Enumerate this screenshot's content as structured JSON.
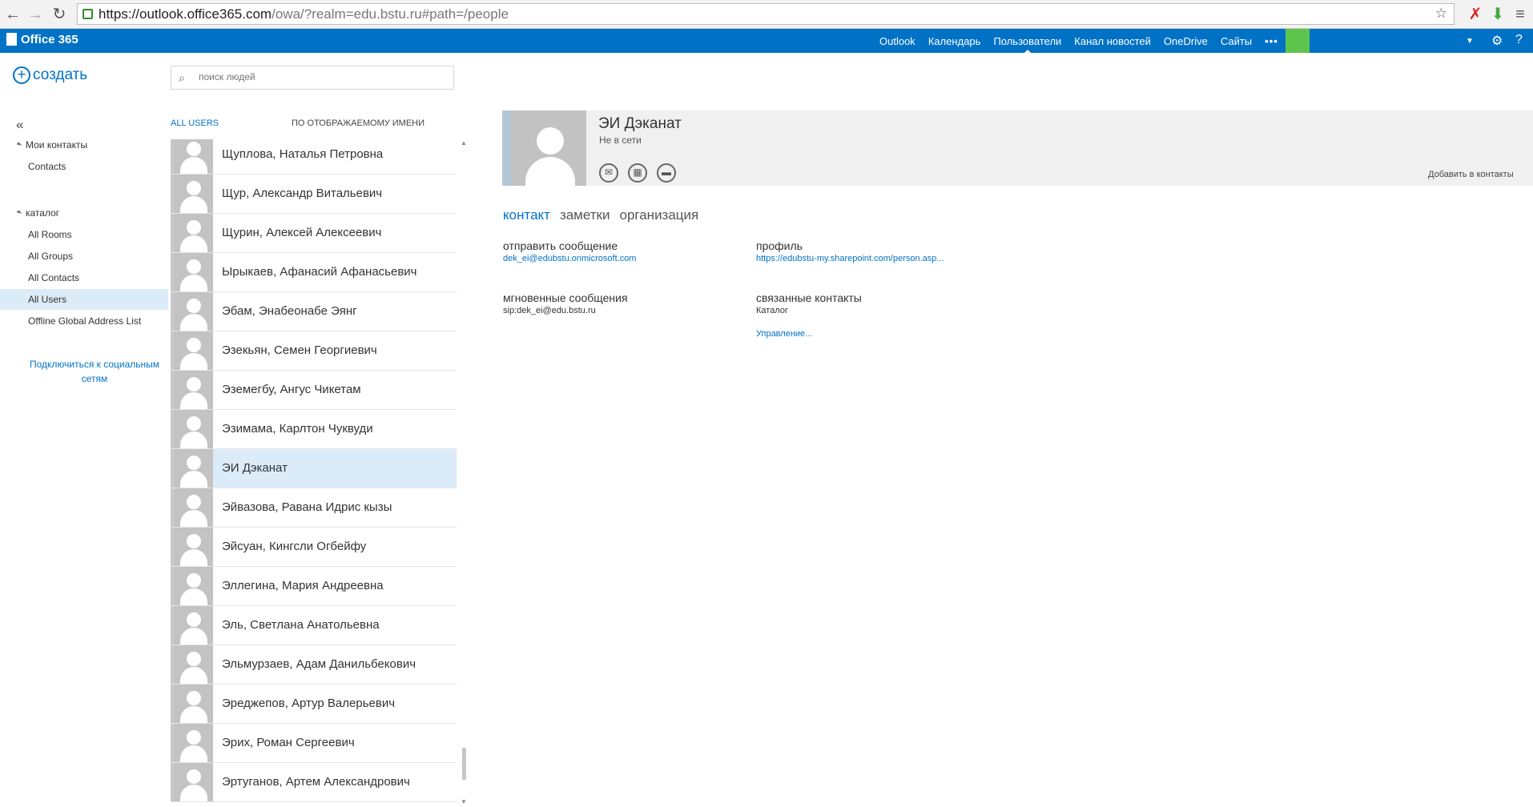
{
  "browser": {
    "url_host": "https://outlook.office365.com",
    "url_rest": "/owa/?realm=edu.bstu.ru#path=/people"
  },
  "suite_bar": {
    "logo": "Office 365",
    "nav": [
      "Outlook",
      "Календарь",
      "Пользователи",
      "Канал новостей",
      "OneDrive",
      "Сайты"
    ],
    "active_nav": "Пользователи",
    "more": "•••",
    "settings_glyph": "⚙",
    "help_glyph": "?"
  },
  "toolbar": {
    "new_label": "создать",
    "search_placeholder": "поиск людей"
  },
  "left_pane": {
    "my_contacts": "Мои контакты",
    "my_contacts_items": [
      "Contacts"
    ],
    "directory": "каталог",
    "directory_items": [
      "All Rooms",
      "All Groups",
      "All Contacts",
      "All Users",
      "Offline Global Address List"
    ],
    "selected_item": "All Users",
    "social_link": "Подключиться к социальным сетям"
  },
  "list": {
    "filter": "ALL USERS",
    "sort": "ПО ОТОБРАЖАЕМОМУ ИМЕНИ",
    "people": [
      "Щуплова, Наталья Петровна",
      "Щур, Александр Витальевич",
      "Щурин, Алексей Алексеевич",
      "Ырыкаев, Афанасий Афанасьевич",
      "Эбам, Энабеонабе Эянг",
      "Эзекьян, Семен Георгиевич",
      "Эземегбу, Ангус Чикетам",
      "Эзимама, Карлтон Чуквуди",
      "ЭИ Дэканат",
      "Эйвазова, Равана Идрис кызы",
      "Эйсуан, Кингсли Огбейфу",
      "Эллегина, Мария Андреевна",
      "Эль, Светлана Анатольевна",
      "Эльмурзаев, Адам Данильбекович",
      "Эреджепов, Артур Валерьевич",
      "Эрих, Роман Сергеевич",
      "Эртуганов, Артем Александрович"
    ],
    "selected_index": 8
  },
  "contact": {
    "name": "ЭИ Дэканат",
    "status": "Не в сети",
    "actions": [
      {
        "icon": "mail-icon",
        "glyph": "✉"
      },
      {
        "icon": "calendar-icon",
        "glyph": "▦"
      },
      {
        "icon": "chat-icon",
        "glyph": "▬"
      }
    ],
    "add_to_contacts": "Добавить в контакты",
    "tabs": [
      "контакт",
      "заметки",
      "организация"
    ],
    "active_tab": "контакт",
    "send_label": "отправить сообщение",
    "send_value": "dek_ei@edubstu.onmicrosoft.com",
    "profile_label": "профиль",
    "profile_value": "https://edubstu-my.sharepoint.com/person.asp...",
    "im_label": "мгновенные сообщения",
    "im_value": "sip:dek_ei@edu.bstu.ru",
    "related_label": "связанные контакты",
    "related_value": "Каталог",
    "manage_link": "Управление..."
  }
}
